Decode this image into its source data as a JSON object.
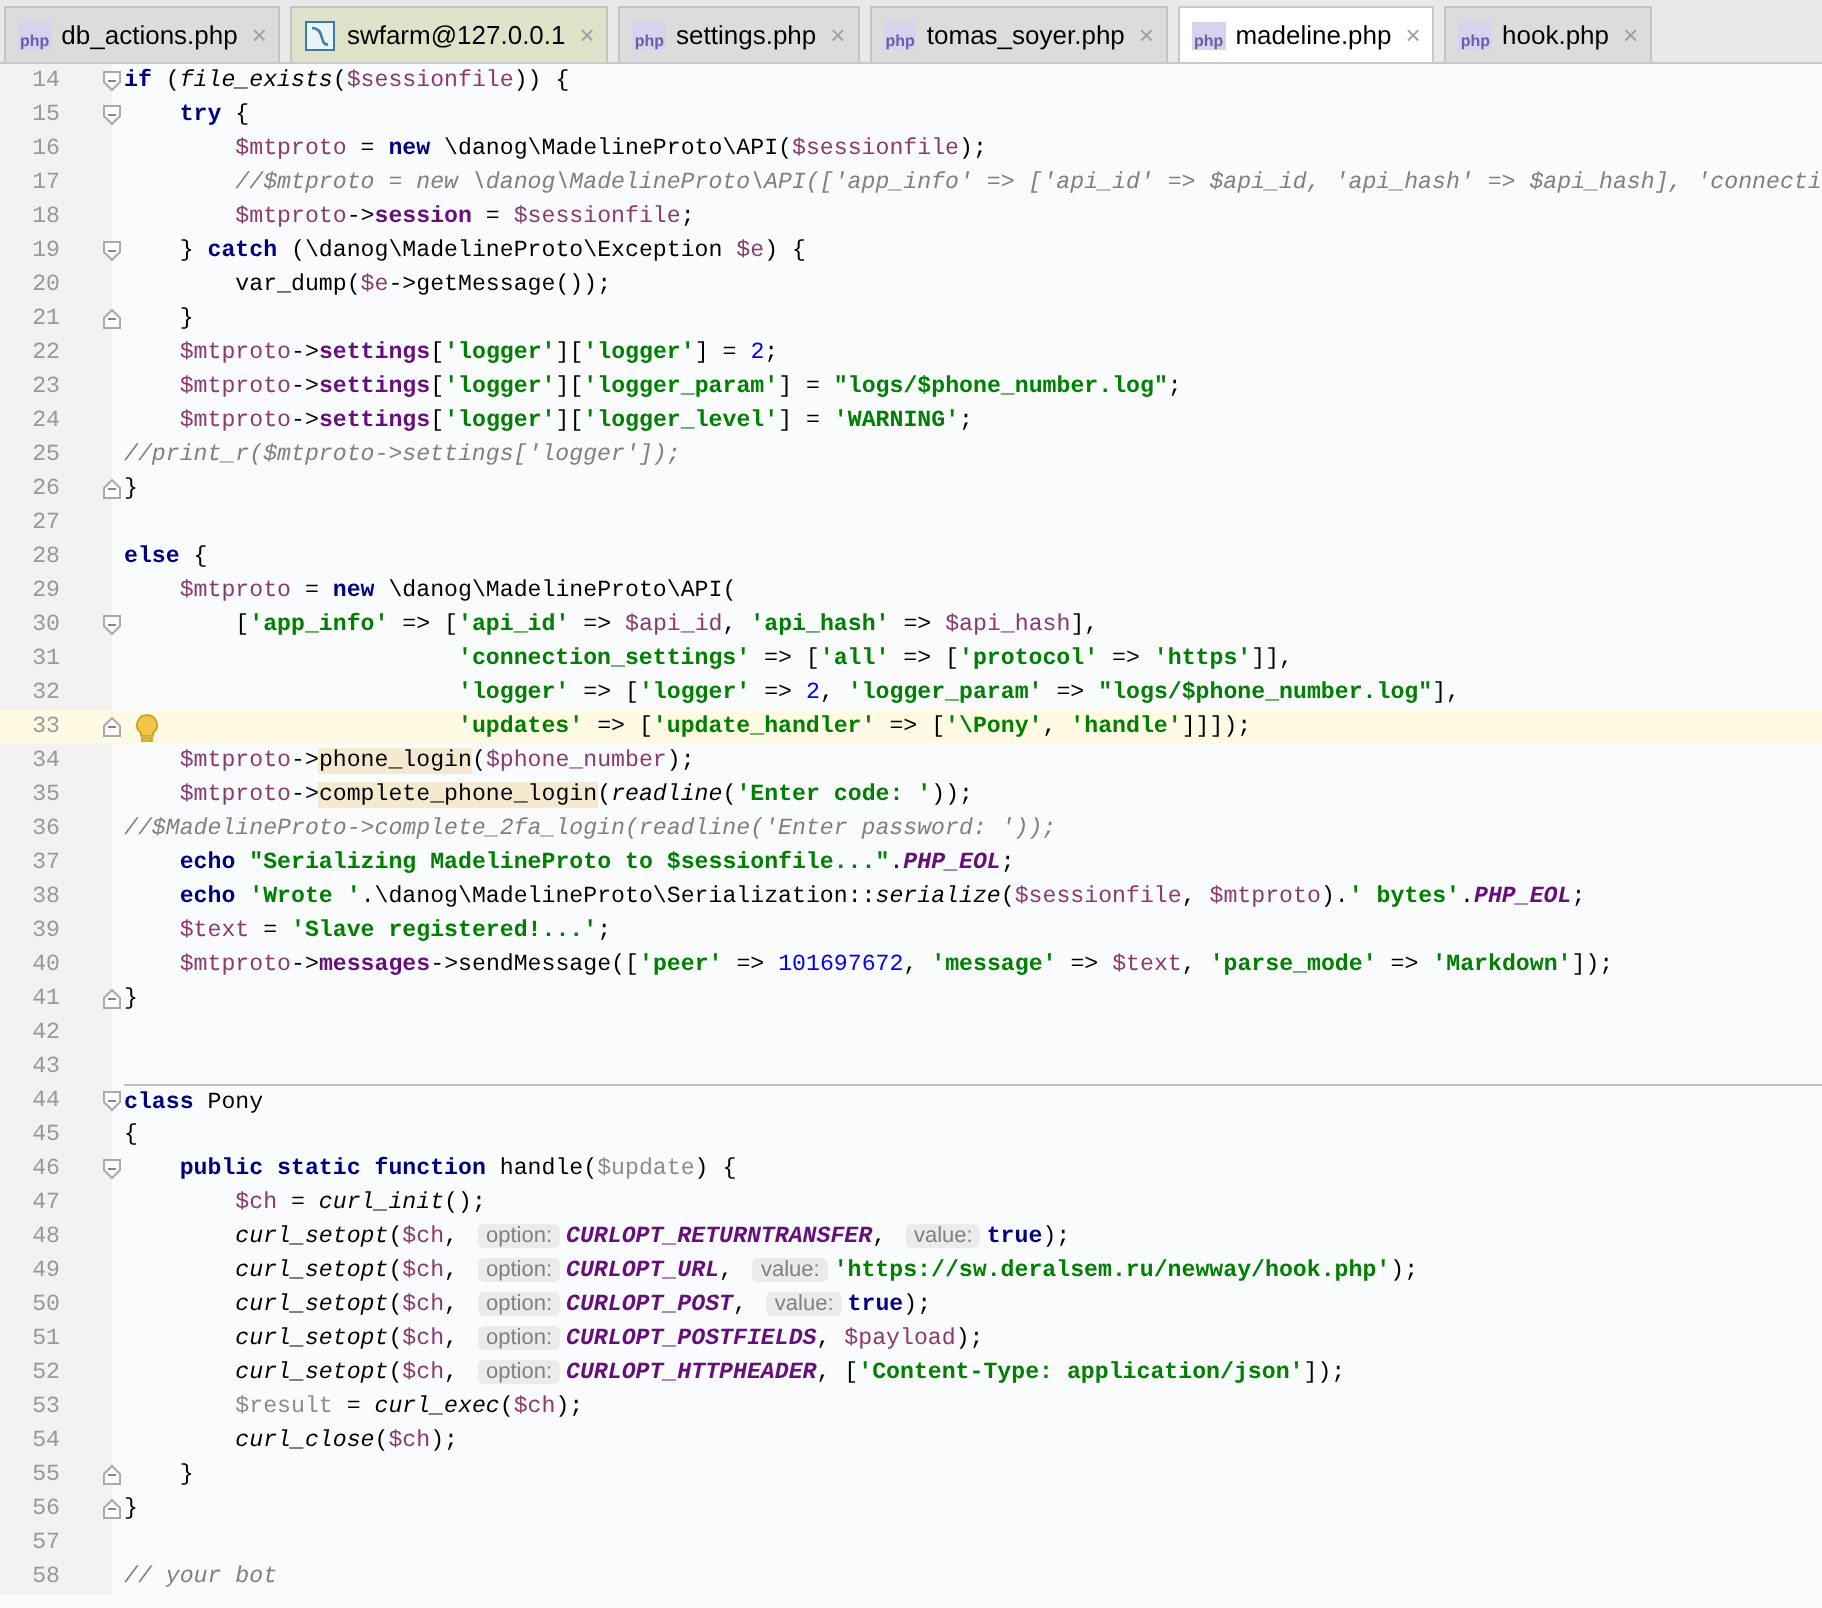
{
  "tabs": [
    {
      "label": "db_actions.php",
      "kind": "php",
      "selected": false
    },
    {
      "label": "swfarm@127.0.0.1",
      "kind": "db",
      "selected": false
    },
    {
      "label": "settings.php",
      "kind": "php",
      "selected": false
    },
    {
      "label": "tomas_soyer.php",
      "kind": "php",
      "selected": false
    },
    {
      "label": "madeline.php",
      "kind": "php",
      "selected": true
    },
    {
      "label": "hook.php",
      "kind": "php",
      "selected": false
    }
  ],
  "close_glyph": "×",
  "file_icon_text": "php",
  "lines": [
    {
      "number": "14",
      "current": false,
      "fold_start": true,
      "fold_end": false,
      "tokens": [
        {
          "kind": "keyword",
          "text": "if"
        },
        {
          "kind": "plain",
          "text": " ("
        },
        {
          "kind": "function",
          "text": "file_exists"
        },
        {
          "kind": "plain",
          "text": "("
        },
        {
          "kind": "variable",
          "text": "$sessionfile"
        },
        {
          "kind": "plain",
          "text": ")) {"
        }
      ]
    },
    {
      "number": "15",
      "current": false,
      "fold_start": true,
      "fold_end": false,
      "tokens": [
        {
          "kind": "keyword",
          "text": "    try"
        },
        {
          "kind": "plain",
          "text": " {"
        }
      ]
    },
    {
      "number": "16",
      "current": false,
      "fold_start": false,
      "fold_end": false,
      "tokens": [
        {
          "kind": "variable",
          "text": "        $mtproto"
        },
        {
          "kind": "plain",
          "text": " = "
        },
        {
          "kind": "keyword",
          "text": "new"
        },
        {
          "kind": "plain",
          "text": " \\danog\\MadelineProto\\API("
        },
        {
          "kind": "variable",
          "text": "$sessionfile"
        },
        {
          "kind": "plain",
          "text": ");"
        }
      ]
    },
    {
      "number": "17",
      "current": false,
      "fold_start": false,
      "fold_end": false,
      "tokens": [
        {
          "kind": "comment",
          "text": "        //$mtproto = new \\danog\\MadelineProto\\API(['app_info' => ['api_id' => $api_id, 'api_hash' => $api_hash], 'connecti"
        }
      ]
    },
    {
      "number": "18",
      "current": false,
      "fold_start": false,
      "fold_end": false,
      "tokens": [
        {
          "kind": "variable",
          "text": "        $mtproto"
        },
        {
          "kind": "plain",
          "text": "->"
        },
        {
          "kind": "property",
          "text": "session"
        },
        {
          "kind": "plain",
          "text": " = "
        },
        {
          "kind": "variable",
          "text": "$sessionfile"
        },
        {
          "kind": "plain",
          "text": ";"
        }
      ]
    },
    {
      "number": "19",
      "current": false,
      "fold_start": true,
      "fold_end": false,
      "tokens": [
        {
          "kind": "plain",
          "text": "    } "
        },
        {
          "kind": "keyword",
          "text": "catch"
        },
        {
          "kind": "plain",
          "text": " (\\danog\\MadelineProto\\Exception "
        },
        {
          "kind": "variable",
          "text": "$e"
        },
        {
          "kind": "plain",
          "text": ") {"
        }
      ]
    },
    {
      "number": "20",
      "current": false,
      "fold_start": false,
      "fold_end": false,
      "tokens": [
        {
          "kind": "plain",
          "text": "        var_dump("
        },
        {
          "kind": "variable",
          "text": "$e"
        },
        {
          "kind": "plain",
          "text": "->getMessage());"
        }
      ]
    },
    {
      "number": "21",
      "current": false,
      "fold_start": false,
      "fold_end": true,
      "tokens": [
        {
          "kind": "plain",
          "text": "    }"
        }
      ]
    },
    {
      "number": "22",
      "current": false,
      "fold_start": false,
      "fold_end": false,
      "tokens": [
        {
          "kind": "variable",
          "text": "    $mtproto"
        },
        {
          "kind": "plain",
          "text": "->"
        },
        {
          "kind": "property",
          "text": "settings"
        },
        {
          "kind": "plain",
          "text": "["
        },
        {
          "kind": "string",
          "text": "'logger'"
        },
        {
          "kind": "plain",
          "text": "]["
        },
        {
          "kind": "string",
          "text": "'logger'"
        },
        {
          "kind": "plain",
          "text": "] = "
        },
        {
          "kind": "number",
          "text": "2"
        },
        {
          "kind": "plain",
          "text": ";"
        }
      ]
    },
    {
      "number": "23",
      "current": false,
      "fold_start": false,
      "fold_end": false,
      "tokens": [
        {
          "kind": "variable",
          "text": "    $mtproto"
        },
        {
          "kind": "plain",
          "text": "->"
        },
        {
          "kind": "property",
          "text": "settings"
        },
        {
          "kind": "plain",
          "text": "["
        },
        {
          "kind": "string",
          "text": "'logger'"
        },
        {
          "kind": "plain",
          "text": "]["
        },
        {
          "kind": "string",
          "text": "'logger_param'"
        },
        {
          "kind": "plain",
          "text": "] = "
        },
        {
          "kind": "string",
          "text": "\"logs/$phone_number.log\""
        },
        {
          "kind": "plain",
          "text": ";"
        }
      ]
    },
    {
      "number": "24",
      "current": false,
      "fold_start": false,
      "fold_end": false,
      "tokens": [
        {
          "kind": "variable",
          "text": "    $mtproto"
        },
        {
          "kind": "plain",
          "text": "->"
        },
        {
          "kind": "property",
          "text": "settings"
        },
        {
          "kind": "plain",
          "text": "["
        },
        {
          "kind": "string",
          "text": "'logger'"
        },
        {
          "kind": "plain",
          "text": "]["
        },
        {
          "kind": "string",
          "text": "'logger_level'"
        },
        {
          "kind": "plain",
          "text": "] = "
        },
        {
          "kind": "string",
          "text": "'WARNING'"
        },
        {
          "kind": "plain",
          "text": ";"
        }
      ]
    },
    {
      "number": "25",
      "current": false,
      "fold_start": false,
      "fold_end": false,
      "tokens": [
        {
          "kind": "comment",
          "text": "//print_r($mtproto->settings['logger']);"
        }
      ]
    },
    {
      "number": "26",
      "current": false,
      "fold_start": false,
      "fold_end": true,
      "tokens": [
        {
          "kind": "plain",
          "text": "}"
        }
      ]
    },
    {
      "number": "27",
      "current": false,
      "fold_start": false,
      "fold_end": false
    },
    {
      "number": "28",
      "current": false,
      "fold_start": false,
      "fold_end": false,
      "tokens": [
        {
          "kind": "keyword",
          "text": "else"
        },
        {
          "kind": "plain",
          "text": " {"
        }
      ]
    },
    {
      "number": "29",
      "current": false,
      "fold_start": false,
      "fold_end": false,
      "tokens": [
        {
          "kind": "variable",
          "text": "    $mtproto"
        },
        {
          "kind": "plain",
          "text": " = "
        },
        {
          "kind": "keyword",
          "text": "new"
        },
        {
          "kind": "plain",
          "text": " \\danog\\MadelineProto\\API("
        }
      ]
    },
    {
      "number": "30",
      "current": false,
      "fold_start": true,
      "fold_end": false,
      "tokens": [
        {
          "kind": "plain",
          "text": "        ["
        },
        {
          "kind": "string",
          "text": "'app_info'"
        },
        {
          "kind": "plain",
          "text": " => ["
        },
        {
          "kind": "string",
          "text": "'api_id'"
        },
        {
          "kind": "plain",
          "text": " => "
        },
        {
          "kind": "variable",
          "text": "$api_id"
        },
        {
          "kind": "plain",
          "text": ", "
        },
        {
          "kind": "string",
          "text": "'api_hash'"
        },
        {
          "kind": "plain",
          "text": " => "
        },
        {
          "kind": "variable",
          "text": "$api_hash"
        },
        {
          "kind": "plain",
          "text": "],"
        }
      ]
    },
    {
      "number": "31",
      "current": false,
      "fold_start": false,
      "fold_end": false,
      "tokens": [
        {
          "kind": "string",
          "text": "                        'connection_settings'"
        },
        {
          "kind": "plain",
          "text": " => ["
        },
        {
          "kind": "string",
          "text": "'all'"
        },
        {
          "kind": "plain",
          "text": " => ["
        },
        {
          "kind": "string",
          "text": "'protocol'"
        },
        {
          "kind": "plain",
          "text": " => "
        },
        {
          "kind": "string",
          "text": "'https'"
        },
        {
          "kind": "plain",
          "text": "]],"
        }
      ]
    },
    {
      "number": "32",
      "current": false,
      "fold_start": false,
      "fold_end": false,
      "tokens": [
        {
          "kind": "string",
          "text": "                        'logger'"
        },
        {
          "kind": "plain",
          "text": " => ["
        },
        {
          "kind": "string",
          "text": "'logger'"
        },
        {
          "kind": "plain",
          "text": " => "
        },
        {
          "kind": "number",
          "text": "2"
        },
        {
          "kind": "plain",
          "text": ", "
        },
        {
          "kind": "string",
          "text": "'logger_param'"
        },
        {
          "kind": "plain",
          "text": " => "
        },
        {
          "kind": "string",
          "text": "\"logs/$phone_number.log\""
        },
        {
          "kind": "plain",
          "text": "],"
        }
      ]
    },
    {
      "number": "33",
      "current": true,
      "fold_start": false,
      "fold_end": true,
      "tokens": [
        {
          "kind": "string",
          "text": "                        'updates'"
        },
        {
          "kind": "plain",
          "text": " => ["
        },
        {
          "kind": "string",
          "text": "'update_handler'"
        },
        {
          "kind": "plain",
          "text": " => ["
        },
        {
          "kind": "string",
          "text": "'\\Pony'"
        },
        {
          "kind": "plain",
          "text": ", "
        },
        {
          "kind": "string",
          "text": "'handle'"
        },
        {
          "kind": "plain",
          "text": "]]]);"
        }
      ]
    },
    {
      "number": "34",
      "current": false,
      "fold_start": false,
      "fold_end": false,
      "tokens": [
        {
          "kind": "variable",
          "text": "    $mtproto"
        },
        {
          "kind": "plain",
          "text": "->"
        },
        {
          "kind": "highlighted",
          "text": "phone_login"
        },
        {
          "kind": "plain",
          "text": "("
        },
        {
          "kind": "variable",
          "text": "$phone_number"
        },
        {
          "kind": "plain",
          "text": ");"
        }
      ]
    },
    {
      "number": "35",
      "current": false,
      "fold_start": false,
      "fold_end": false,
      "tokens": [
        {
          "kind": "variable",
          "text": "    $mtproto"
        },
        {
          "kind": "plain",
          "text": "->"
        },
        {
          "kind": "highlighted",
          "text": "complete_phone_login"
        },
        {
          "kind": "plain",
          "text": "("
        },
        {
          "kind": "function",
          "text": "readline"
        },
        {
          "kind": "plain",
          "text": "("
        },
        {
          "kind": "string",
          "text": "'Enter code: '"
        },
        {
          "kind": "plain",
          "text": "));"
        }
      ]
    },
    {
      "number": "36",
      "current": false,
      "fold_start": false,
      "fold_end": false,
      "tokens": [
        {
          "kind": "comment",
          "text": "//$MadelineProto->complete_2fa_login(readline('Enter password: '));"
        }
      ]
    },
    {
      "number": "37",
      "current": false,
      "fold_start": false,
      "fold_end": false,
      "tokens": [
        {
          "kind": "keyword",
          "text": "    echo "
        },
        {
          "kind": "string",
          "text": "\"Serializing MadelineProto to $sessionfile...\""
        },
        {
          "kind": "plain",
          "text": "."
        },
        {
          "kind": "constant",
          "text": "PHP_EOL"
        },
        {
          "kind": "plain",
          "text": ";"
        }
      ]
    },
    {
      "number": "38",
      "current": false,
      "fold_start": false,
      "fold_end": false,
      "tokens": [
        {
          "kind": "keyword",
          "text": "    echo "
        },
        {
          "kind": "string",
          "text": "'Wrote '"
        },
        {
          "kind": "plain",
          "text": ".\\danog\\MadelineProto\\Serialization::"
        },
        {
          "kind": "function",
          "text": "serialize"
        },
        {
          "kind": "plain",
          "text": "("
        },
        {
          "kind": "variable",
          "text": "$sessionfile"
        },
        {
          "kind": "plain",
          "text": ", "
        },
        {
          "kind": "variable",
          "text": "$mtproto"
        },
        {
          "kind": "plain",
          "text": ")."
        },
        {
          "kind": "string",
          "text": "' bytes'"
        },
        {
          "kind": "plain",
          "text": "."
        },
        {
          "kind": "constant",
          "text": "PHP_EOL"
        },
        {
          "kind": "plain",
          "text": ";"
        }
      ]
    },
    {
      "number": "39",
      "current": false,
      "fold_start": false,
      "fold_end": false,
      "tokens": [
        {
          "kind": "variable",
          "text": "    $text"
        },
        {
          "kind": "plain",
          "text": " = "
        },
        {
          "kind": "string",
          "text": "'Slave registered!...'"
        },
        {
          "kind": "plain",
          "text": ";"
        }
      ]
    },
    {
      "number": "40",
      "current": false,
      "fold_start": false,
      "fold_end": false,
      "tokens": [
        {
          "kind": "variable",
          "text": "    $mtproto"
        },
        {
          "kind": "plain",
          "text": "->"
        },
        {
          "kind": "property",
          "text": "messages"
        },
        {
          "kind": "plain",
          "text": "->sendMessage(["
        },
        {
          "kind": "string",
          "text": "'peer'"
        },
        {
          "kind": "plain",
          "text": " => "
        },
        {
          "kind": "number",
          "text": "101697672"
        },
        {
          "kind": "plain",
          "text": ", "
        },
        {
          "kind": "string",
          "text": "'message'"
        },
        {
          "kind": "plain",
          "text": " => "
        },
        {
          "kind": "variable",
          "text": "$text"
        },
        {
          "kind": "plain",
          "text": ", "
        },
        {
          "kind": "string",
          "text": "'parse_mode'"
        },
        {
          "kind": "plain",
          "text": " => "
        },
        {
          "kind": "string",
          "text": "'Markdown'"
        },
        {
          "kind": "plain",
          "text": "]);"
        }
      ]
    },
    {
      "number": "41",
      "current": false,
      "fold_start": false,
      "fold_end": true,
      "tokens": [
        {
          "kind": "plain",
          "text": "}"
        }
      ]
    },
    {
      "number": "42",
      "current": false,
      "fold_start": false,
      "fold_end": false
    },
    {
      "number": "43",
      "current": false,
      "fold_start": false,
      "fold_end": false
    },
    {
      "number": "44",
      "current": false,
      "fold_start": true,
      "fold_end": false,
      "tokens": [
        {
          "kind": "keyword",
          "text": "class"
        },
        {
          "kind": "plain",
          "text": " Pony"
        }
      ]
    },
    {
      "number": "45",
      "current": false,
      "fold_start": false,
      "fold_end": false,
      "tokens": [
        {
          "kind": "plain",
          "text": "{"
        }
      ]
    },
    {
      "number": "46",
      "current": false,
      "fold_start": true,
      "fold_end": false,
      "tokens": [
        {
          "kind": "keyword",
          "text": "    public static function"
        },
        {
          "kind": "plain",
          "text": " handle("
        },
        {
          "kind": "unused",
          "text": "$update"
        },
        {
          "kind": "plain",
          "text": ") {"
        }
      ]
    },
    {
      "number": "47",
      "current": false,
      "fold_start": false,
      "fold_end": false,
      "tokens": [
        {
          "kind": "variable",
          "text": "        $ch"
        },
        {
          "kind": "plain",
          "text": " = "
        },
        {
          "kind": "function",
          "text": "curl_init"
        },
        {
          "kind": "plain",
          "text": "();"
        }
      ]
    },
    {
      "number": "48",
      "current": false,
      "fold_start": false,
      "fold_end": false,
      "tokens": [
        {
          "kind": "function",
          "text": "        curl_setopt"
        },
        {
          "kind": "plain",
          "text": "("
        },
        {
          "kind": "variable",
          "text": "$ch"
        },
        {
          "kind": "plain",
          "text": ", "
        },
        {
          "kind": "hint",
          "text": "option:"
        },
        {
          "kind": "constant",
          "text": "CURLOPT_RETURNTRANSFER"
        },
        {
          "kind": "plain",
          "text": ", "
        },
        {
          "kind": "hint",
          "text": "value:"
        },
        {
          "kind": "keyword",
          "text": "true"
        },
        {
          "kind": "plain",
          "text": ");"
        }
      ]
    },
    {
      "number": "49",
      "current": false,
      "fold_start": false,
      "fold_end": false,
      "tokens": [
        {
          "kind": "function",
          "text": "        curl_setopt"
        },
        {
          "kind": "plain",
          "text": "("
        },
        {
          "kind": "variable",
          "text": "$ch"
        },
        {
          "kind": "plain",
          "text": ", "
        },
        {
          "kind": "hint",
          "text": "option:"
        },
        {
          "kind": "constant",
          "text": "CURLOPT_URL"
        },
        {
          "kind": "plain",
          "text": ", "
        },
        {
          "kind": "hint",
          "text": "value:"
        },
        {
          "kind": "string",
          "text": "'https://sw.deralsem.ru/newway/hook.php'"
        },
        {
          "kind": "plain",
          "text": ");"
        }
      ]
    },
    {
      "number": "50",
      "current": false,
      "fold_start": false,
      "fold_end": false,
      "tokens": [
        {
          "kind": "function",
          "text": "        curl_setopt"
        },
        {
          "kind": "plain",
          "text": "("
        },
        {
          "kind": "variable",
          "text": "$ch"
        },
        {
          "kind": "plain",
          "text": ", "
        },
        {
          "kind": "hint",
          "text": "option:"
        },
        {
          "kind": "constant",
          "text": "CURLOPT_POST"
        },
        {
          "kind": "plain",
          "text": ", "
        },
        {
          "kind": "hint",
          "text": "value:"
        },
        {
          "kind": "keyword",
          "text": "true"
        },
        {
          "kind": "plain",
          "text": ");"
        }
      ]
    },
    {
      "number": "51",
      "current": false,
      "fold_start": false,
      "fold_end": false,
      "tokens": [
        {
          "kind": "function",
          "text": "        curl_setopt"
        },
        {
          "kind": "plain",
          "text": "("
        },
        {
          "kind": "variable",
          "text": "$ch"
        },
        {
          "kind": "plain",
          "text": ", "
        },
        {
          "kind": "hint",
          "text": "option:"
        },
        {
          "kind": "constant",
          "text": "CURLOPT_POSTFIELDS"
        },
        {
          "kind": "plain",
          "text": ", "
        },
        {
          "kind": "variable",
          "text": "$payload"
        },
        {
          "kind": "plain",
          "text": ");"
        }
      ]
    },
    {
      "number": "52",
      "current": false,
      "fold_start": false,
      "fold_end": false,
      "tokens": [
        {
          "kind": "function",
          "text": "        curl_setopt"
        },
        {
          "kind": "plain",
          "text": "("
        },
        {
          "kind": "variable",
          "text": "$ch"
        },
        {
          "kind": "plain",
          "text": ", "
        },
        {
          "kind": "hint",
          "text": "option:"
        },
        {
          "kind": "constant",
          "text": "CURLOPT_HTTPHEADER"
        },
        {
          "kind": "plain",
          "text": ", ["
        },
        {
          "kind": "string",
          "text": "'Content-Type: application/json'"
        },
        {
          "kind": "plain",
          "text": "]);"
        }
      ]
    },
    {
      "number": "53",
      "current": false,
      "fold_start": false,
      "fold_end": false,
      "tokens": [
        {
          "kind": "unused",
          "text": "        $result"
        },
        {
          "kind": "plain",
          "text": " = "
        },
        {
          "kind": "function",
          "text": "curl_exec"
        },
        {
          "kind": "plain",
          "text": "("
        },
        {
          "kind": "variable",
          "text": "$ch"
        },
        {
          "kind": "plain",
          "text": ");"
        }
      ]
    },
    {
      "number": "54",
      "current": false,
      "fold_start": false,
      "fold_end": false,
      "tokens": [
        {
          "kind": "function",
          "text": "        curl_close"
        },
        {
          "kind": "plain",
          "text": "("
        },
        {
          "kind": "variable",
          "text": "$ch"
        },
        {
          "kind": "plain",
          "text": ");"
        }
      ]
    },
    {
      "number": "55",
      "current": false,
      "fold_start": false,
      "fold_end": true,
      "tokens": [
        {
          "kind": "plain",
          "text": "    }"
        }
      ]
    },
    {
      "number": "56",
      "current": false,
      "fold_start": false,
      "fold_end": true,
      "tokens": [
        {
          "kind": "plain",
          "text": "}"
        }
      ]
    },
    {
      "number": "57",
      "current": false,
      "fold_start": false,
      "fold_end": false
    },
    {
      "number": "58",
      "current": false,
      "fold_start": false,
      "fold_end": false,
      "tokens": [
        {
          "kind": "comment",
          "text": "// your bot"
        }
      ]
    }
  ]
}
